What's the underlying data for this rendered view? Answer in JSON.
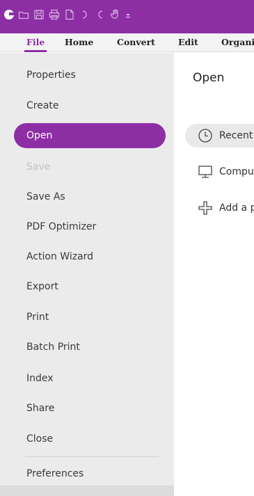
{
  "toolbar": {
    "icons": [
      "app-logo",
      "open-folder-icon",
      "save-icon",
      "print-icon",
      "new-document-icon",
      "undo-icon",
      "redo-icon",
      "hand-tool-icon",
      "customize-arrow-icon"
    ],
    "accent": "#8d2ea5"
  },
  "ribbon": {
    "tabs": [
      {
        "label": "File",
        "active": true
      },
      {
        "label": "Home"
      },
      {
        "label": "Convert"
      },
      {
        "label": "Edit"
      },
      {
        "label": "Organi"
      }
    ]
  },
  "sidebar": {
    "items": [
      {
        "label": "Properties"
      },
      {
        "label": "Create"
      },
      {
        "label": "Open",
        "active": true
      },
      {
        "label": "Save",
        "disabled": true
      },
      {
        "label": "Save As"
      },
      {
        "label": "PDF Optimizer"
      },
      {
        "label": "Action Wizard"
      },
      {
        "label": "Export"
      },
      {
        "label": "Print"
      },
      {
        "label": "Batch Print"
      },
      {
        "label": "Index"
      },
      {
        "label": "Share"
      },
      {
        "label": "Close"
      }
    ],
    "footer_item": {
      "label": "Preferences"
    }
  },
  "main": {
    "title": "Open",
    "options": [
      {
        "label": "Recent",
        "icon": "clock-icon",
        "selected": true
      },
      {
        "label": "Compu",
        "icon": "computer-monitor-icon"
      },
      {
        "label": "Add a p",
        "icon": "add-place-icon"
      }
    ]
  }
}
